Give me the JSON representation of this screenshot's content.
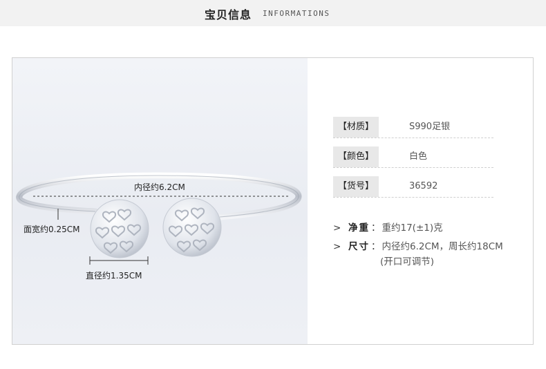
{
  "header": {
    "title": "宝贝信息",
    "subtitle": "INFORMATIONS"
  },
  "product_image": {
    "icon": "bracelet-photo",
    "dimensions": {
      "inner_diameter": "内径约6.2CM",
      "band_width": "面宽约0.25CM",
      "ball_diameter": "直径约1.35CM"
    }
  },
  "specs": [
    {
      "key": "【材质】",
      "value": "S990足银"
    },
    {
      "key": "【颜色】",
      "value": "白色"
    },
    {
      "key": "【货号】",
      "value": "36592"
    }
  ],
  "details": [
    {
      "arrow": ">",
      "key": "净重",
      "colon": "：",
      "value": "重约17(±1)克"
    },
    {
      "arrow": ">",
      "key": "尺寸",
      "colon": "：",
      "value": "内径约6.2CM，周长约18CM",
      "value_line2": "(开口可调节)"
    }
  ],
  "colors": {
    "header_band": "#f2f2f2",
    "frame_border": "#d0d0d0",
    "key_bg": "#e8e8e8"
  }
}
